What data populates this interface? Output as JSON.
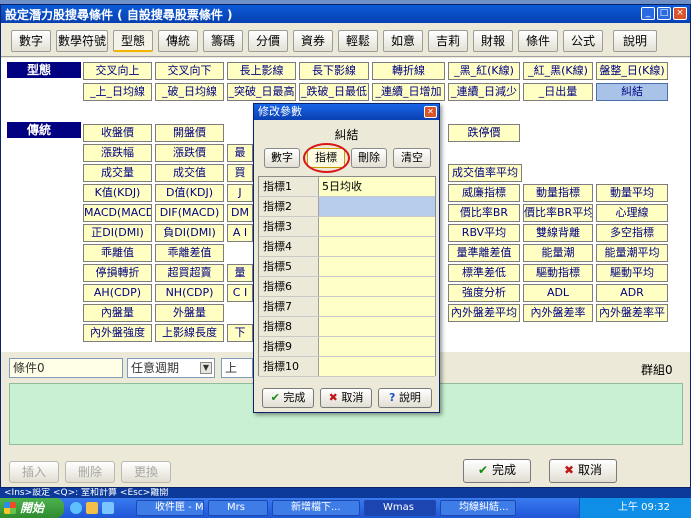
{
  "window": {
    "title": "設定潛力股搜尋條件 ( 自設搜尋股票條件 )",
    "minimize_glyph": "_",
    "maximize_glyph": "□",
    "close_glyph": "×"
  },
  "toolbar": {
    "tabs": [
      {
        "label": "數字"
      },
      {
        "label": "數學符號"
      },
      {
        "label": "型態"
      },
      {
        "label": "傳統"
      },
      {
        "label": "籌碼"
      },
      {
        "label": "分價"
      },
      {
        "label": "資券"
      },
      {
        "label": "輕鬆"
      },
      {
        "label": "如意"
      },
      {
        "label": "吉莉"
      },
      {
        "label": "財報"
      },
      {
        "label": "條件"
      },
      {
        "label": "公式"
      },
      {
        "label": "說明"
      }
    ]
  },
  "sections": {
    "pattern": {
      "label": "型態",
      "cells": [
        "交叉向上",
        "交叉向下",
        "長上影線",
        "長下影線",
        "轉折線",
        "_黑_紅(K線)",
        "_紅_黑(K線)",
        "盤整_日(K線)",
        "_上_日均線",
        "_破_日均線",
        "_突破_日最高",
        "_跌破_日最低",
        "_連續_日增加",
        "_連續_日減少",
        "_日出量",
        "糾結"
      ]
    },
    "traditional": {
      "label": "傳統",
      "left_cells": [
        "收盤價",
        "開盤價",
        "漲跌幅",
        "漲跌價",
        "成交量",
        "成交值",
        "K值(KDJ)",
        "D值(KDJ)",
        "MACD(MACD)",
        "DIF(MACD)",
        "正DI(DMI)",
        "負DI(DMI)",
        "乖離值",
        "乖離差值",
        "停損轉折",
        "超買超賣",
        "AH(CDP)",
        "NH(CDP)",
        "內盤量",
        "外盤量",
        "內外盤強度",
        "上影線長度"
      ],
      "mid_peeks": [
        "最",
        "買",
        "J",
        "DM",
        "A I",
        "量",
        "C I",
        "下"
      ],
      "right_cells": [
        "跌停價",
        "成交值率平均",
        "威廉指標",
        "動量指標",
        "動量平均",
        "價比率BR",
        "價比率BR平均",
        "心理線",
        "RBV平均",
        "雙線背離",
        "多空指標",
        "量準離差值",
        "能量潮",
        "能量潮平均",
        "標準差低",
        "驅動指標",
        "驅動平均",
        "強度分析",
        "ADL",
        "ADR",
        "內外盤差平均",
        "內外盤差率",
        "內外盤差率平"
      ]
    }
  },
  "condition_row": {
    "condition_name": "條件0",
    "period_select": "任意週期",
    "peek_text": "上",
    "group_label": "群組0"
  },
  "bottom": {
    "insert_label": "插入",
    "delete_label": "刪除",
    "replace_label": "更換",
    "confirm_label": "完成",
    "cancel_label": "取消"
  },
  "dialog": {
    "title": "修改參數",
    "heading": "糾結",
    "tab_buttons": [
      {
        "label": "數字"
      },
      {
        "label": "指標"
      },
      {
        "label": "刪除"
      },
      {
        "label": "清空"
      }
    ],
    "rows": [
      {
        "label": "指標1",
        "value": "5日均收"
      },
      {
        "label": "指標2",
        "value": ""
      },
      {
        "label": "指標3",
        "value": ""
      },
      {
        "label": "指標4",
        "value": ""
      },
      {
        "label": "指標5",
        "value": ""
      },
      {
        "label": "指標6",
        "value": ""
      },
      {
        "label": "指標7",
        "value": ""
      },
      {
        "label": "指標8",
        "value": ""
      },
      {
        "label": "指標9",
        "value": ""
      },
      {
        "label": "指標10",
        "value": ""
      }
    ],
    "confirm_label": "完成",
    "cancel_label": "取消",
    "help_label": "說明"
  },
  "hint_bar": {
    "text": "<Ins>設定   <Q>: 室和計算   <Esc>離開"
  },
  "taskbar": {
    "start_label": "開始",
    "tasks": [
      {
        "label": "收件匣 - M..."
      },
      {
        "label": "Mrs"
      },
      {
        "label": "新增檔下..."
      },
      {
        "label": "Wmas"
      },
      {
        "label": "均線糾結..."
      }
    ],
    "tray_text": "上午 09:32"
  },
  "colors": {
    "cell_bg": "#ffffc4",
    "cell_text": "#000080",
    "section_bg": "#000080",
    "selection": "#a9c3e8",
    "highlight_circle": "#d81818"
  }
}
